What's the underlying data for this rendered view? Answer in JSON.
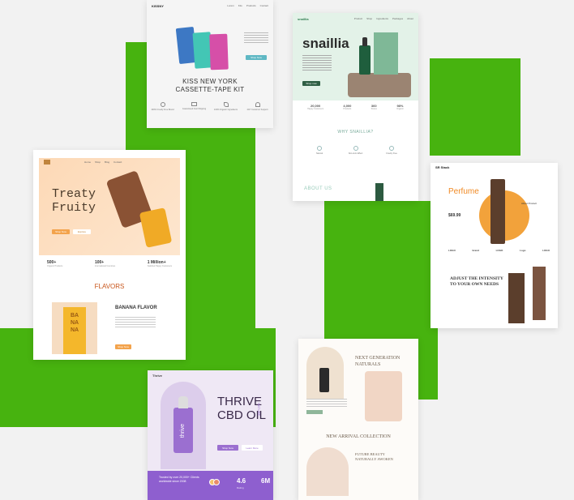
{
  "colors": {
    "background": "#f2f2f2",
    "accent_green": "#47b30f"
  },
  "kiss": {
    "brand": "KISSNY",
    "nav": [
      "Lorem",
      "Kits",
      "Products",
      "Contact"
    ],
    "title_line1": "KISS NEW YORK",
    "title_line2": "CASSETTE-TAPE KIT",
    "button": "Shop Now",
    "features": [
      "100% Cruelty Free Brand",
      "Guaranteed Fast Shipping",
      "100% Organic Ingredients",
      "24/7 Customer Support"
    ]
  },
  "snaillia": {
    "brand": "snaillia",
    "nav": [
      "Product",
      "Shop",
      "Ingredients",
      "Packages",
      "About"
    ],
    "title": "snaillia",
    "button": "Shop now",
    "stats": [
      {
        "value": "20,000",
        "label": "Happy Customers"
      },
      {
        "value": "4,000",
        "label": "Products"
      },
      {
        "value": "360",
        "label": "Stores"
      },
      {
        "value": "98%",
        "label": "Organic"
      }
    ],
    "why_heading": "WHY SNAILLIA?",
    "why_items": [
      "Natural",
      "Non-toxic Effect",
      "Cruelty Free"
    ],
    "about_heading": "ABOUT US"
  },
  "treaty": {
    "title_line1": "Treaty",
    "title_line2": "Fruity",
    "nav": [
      "Home",
      "Shop",
      "Blog",
      "Contact"
    ],
    "buttons": [
      "Shop Now",
      "Explore"
    ],
    "stats": [
      {
        "value": "500+",
        "label": "Organic Products"
      },
      {
        "value": "100+",
        "label": "International Countries"
      },
      {
        "value": "1 Million+",
        "label": "Satisfied Happy Customers"
      }
    ],
    "flavors_heading": "FLAVORS",
    "flavor_title": "BANANA FLAVOR",
    "can_text": [
      "BA",
      "NA",
      "NA"
    ],
    "button": "Shop Now"
  },
  "perfume": {
    "brand": "SR Stack",
    "title": "Perfume",
    "price": "$69.99",
    "about": "About Product",
    "logos": [
      "LOGO",
      "brand",
      "LOGO",
      "Logo",
      "LOGO"
    ],
    "heading_line1": "ADJUST THE INTENSITY",
    "heading_line2": "TO YOUR OWN NEEDS"
  },
  "natural": {
    "heading_line1": "NEXT GENERATION",
    "heading_line2": "NATURALS",
    "arrival": "NEW ARRIVAL COLLECTION",
    "future_line1": "FUTURE BEAUTY",
    "future_line2": "NATURALLY AWOKEN"
  },
  "thrive": {
    "brand": "Thrive",
    "title_line1": "THRIVE",
    "title_line2": "CBD OIL",
    "vertical": "NATURE",
    "bottle_label": "thrive",
    "buttons": [
      "Shop Now",
      "Learn More"
    ],
    "trusted": "Trusted by over 20,000+ Clients worldwide since 2008",
    "rating": "4.6",
    "rating_label": "Rating",
    "count": "6M"
  }
}
